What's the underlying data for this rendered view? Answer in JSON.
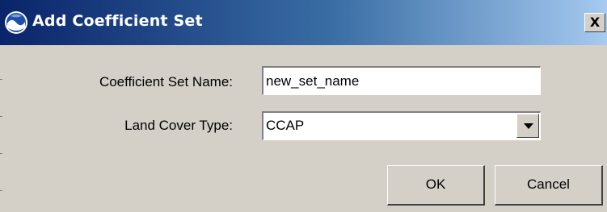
{
  "window": {
    "title": "Add Coefficient Set",
    "close_label": "X"
  },
  "form": {
    "name_label": "Coefficient Set Name:",
    "name_value": "new_set_name",
    "type_label": "Land Cover Type:",
    "type_value": "CCAP"
  },
  "buttons": {
    "ok_label": "OK",
    "cancel_label": "Cancel"
  }
}
